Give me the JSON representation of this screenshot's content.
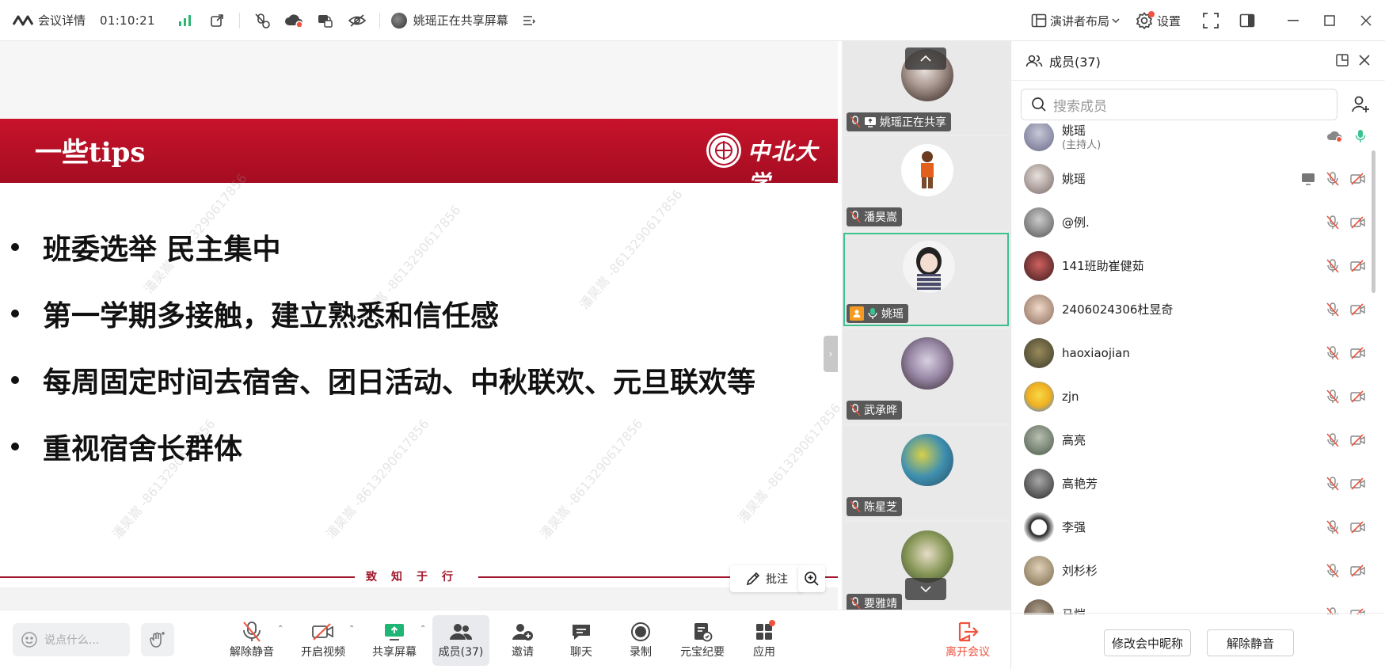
{
  "topbar": {
    "title": "会议详情",
    "timer": "01:10:21",
    "sharing_status": "姚瑶正在共享屏幕",
    "layout_label": "演讲者布局",
    "settings_label": "设置"
  },
  "slide": {
    "banner_title": "一些tips",
    "university_name": "中北大学",
    "bullets": [
      "班委选举 民主集中",
      "第一学期多接触，建立熟悉和信任感",
      "每周固定时间去宿舍、团日活动、中秋联欢、元旦联欢等",
      "重视宿舍长群体"
    ],
    "motto": "致知于行",
    "watermark": "潘昊嵩 -8613290617856",
    "annotate_label": "批注"
  },
  "video_strip": {
    "tiles": [
      {
        "name": "姚瑶正在共享",
        "muted": true,
        "sharing": true
      },
      {
        "name": "潘昊嵩",
        "muted": true
      },
      {
        "name": "姚瑶",
        "muted": false,
        "host": true,
        "active": true
      },
      {
        "name": "武承晔",
        "muted": true
      },
      {
        "name": "陈星芝",
        "muted": true
      },
      {
        "name": "要雅靖",
        "muted": true
      }
    ]
  },
  "members": {
    "header": "成员(37)",
    "search_placeholder": "搜索成员",
    "list": [
      {
        "name": "姚瑶",
        "sub": "(主持人)",
        "mic_on": true,
        "partial": true
      },
      {
        "name": "姚瑶",
        "sharing": true
      },
      {
        "name": "@例."
      },
      {
        "name": "141班助崔健茹"
      },
      {
        "name": "2406024306杜昱奇"
      },
      {
        "name": "haoxiaojian"
      },
      {
        "name": "zjn"
      },
      {
        "name": "高亮"
      },
      {
        "name": "高艳芳"
      },
      {
        "name": "李强"
      },
      {
        "name": "刘杉杉"
      },
      {
        "name": "马恺"
      }
    ],
    "rename_button": "修改会中昵称",
    "unmute_all_button": "解除静音"
  },
  "toolbar": {
    "chat_placeholder": "说点什么...",
    "unmute": "解除静音",
    "video": "开启视频",
    "share": "共享屏幕",
    "members": "成员(37)",
    "invite": "邀请",
    "chat": "聊天",
    "record": "录制",
    "summary": "元宝纪要",
    "apps": "应用",
    "leave": "离开会议"
  },
  "colors": {
    "banner_red": "#b5102a",
    "active_green": "#3bc28e",
    "leave_red": "#f0523d",
    "share_green": "#1fb574"
  }
}
